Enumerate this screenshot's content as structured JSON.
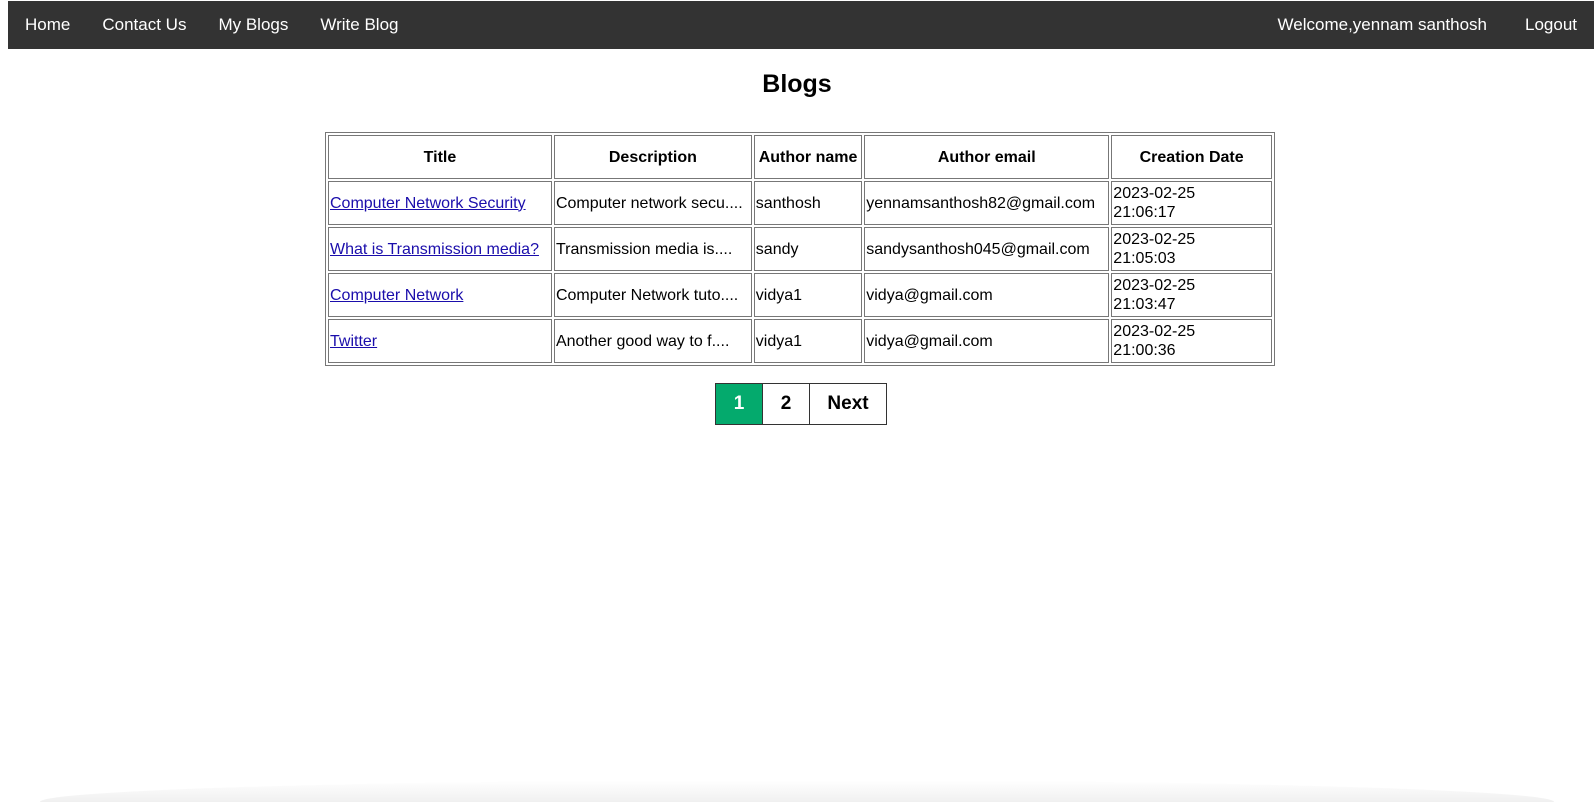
{
  "nav": {
    "links": [
      "Home",
      "Contact Us",
      "My Blogs",
      "Write Blog"
    ],
    "welcome": "Welcome,yennam santhosh",
    "logout": "Logout"
  },
  "page_title": "Blogs",
  "table": {
    "headers": [
      "Title",
      "Description",
      "Author name",
      "Author email",
      "Creation Date"
    ],
    "rows": [
      {
        "title": "Computer Network Security",
        "description": "Computer network secu....",
        "author": "santhosh",
        "email": "yennamsanthosh82@gmail.com",
        "date": "2023-02-25",
        "time": "21:06:17"
      },
      {
        "title": "What is Transmission media?",
        "description": "Transmission media is....",
        "author": "sandy",
        "email": "sandysanthosh045@gmail.com",
        "date": "2023-02-25",
        "time": "21:05:03"
      },
      {
        "title": "Computer Network",
        "description": "Computer Network tuto....",
        "author": "vidya1",
        "email": "vidya@gmail.com",
        "date": "2023-02-25",
        "time": "21:03:47"
      },
      {
        "title": "Twitter",
        "description": "Another good way to f....",
        "author": "vidya1",
        "email": "vidya@gmail.com",
        "date": "2023-02-25",
        "time": "21:00:36"
      }
    ]
  },
  "pagination": {
    "pages": [
      "1",
      "2"
    ],
    "active_page": "1",
    "next_label": "Next"
  },
  "colors": {
    "nav_bg": "#333333",
    "active_page_bg": "#04AA6D",
    "link": "#1a0dab"
  }
}
